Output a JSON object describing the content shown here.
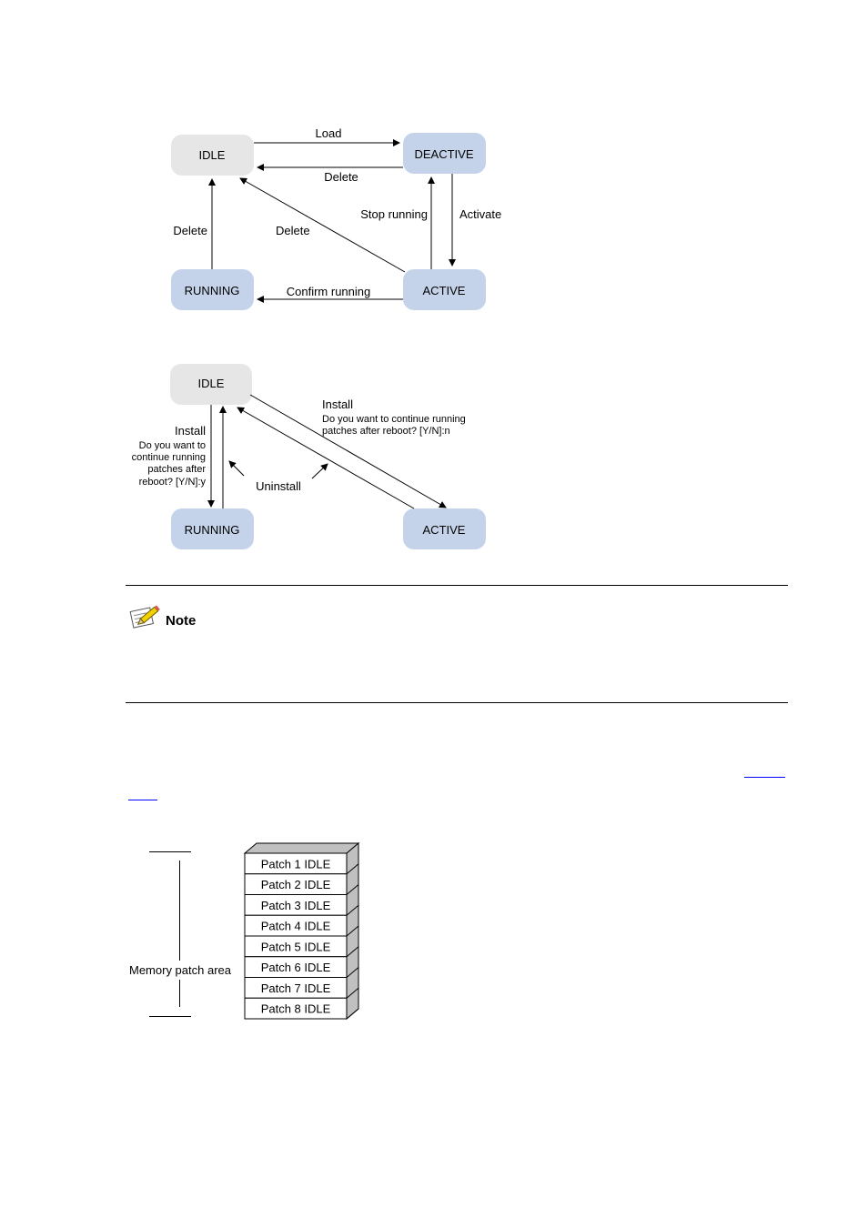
{
  "diagram1": {
    "states": {
      "idle": "IDLE",
      "deactive": "DEACTIVE",
      "running": "RUNNING",
      "active": "ACTIVE"
    },
    "transitions": {
      "load": "Load",
      "delete_deactive_idle": "Delete",
      "stop_running": "Stop running",
      "activate": "Activate",
      "delete_running_idle": "Delete",
      "delete_active_idle": "Delete",
      "confirm_running": "Confirm running"
    }
  },
  "diagram2": {
    "states": {
      "idle": "IDLE",
      "running": "RUNNING",
      "active": "ACTIVE"
    },
    "install_yes": {
      "title": "Install",
      "lines": [
        "Do you want to",
        "continue running",
        "patches after",
        "reboot? [Y/N]:y"
      ]
    },
    "install_no": {
      "title": "Install",
      "lines": [
        "Do you want to continue running",
        "patches after reboot? [Y/N]:n"
      ]
    },
    "uninstall": "Uninstall"
  },
  "note": {
    "label": "Note"
  },
  "memory": {
    "area_label": "Memory patch area",
    "patches": [
      "Patch 1 IDLE",
      "Patch 2 IDLE",
      "Patch 3 IDLE",
      "Patch 4 IDLE",
      "Patch 5 IDLE",
      "Patch 6 IDLE",
      "Patch 7 IDLE",
      "Patch 8 IDLE"
    ]
  },
  "colors": {
    "idle_fill": "#e6e6e6",
    "state_fill": "#c5d3ea",
    "link": "#0000ff",
    "stack_side": "#c0c0c0"
  }
}
